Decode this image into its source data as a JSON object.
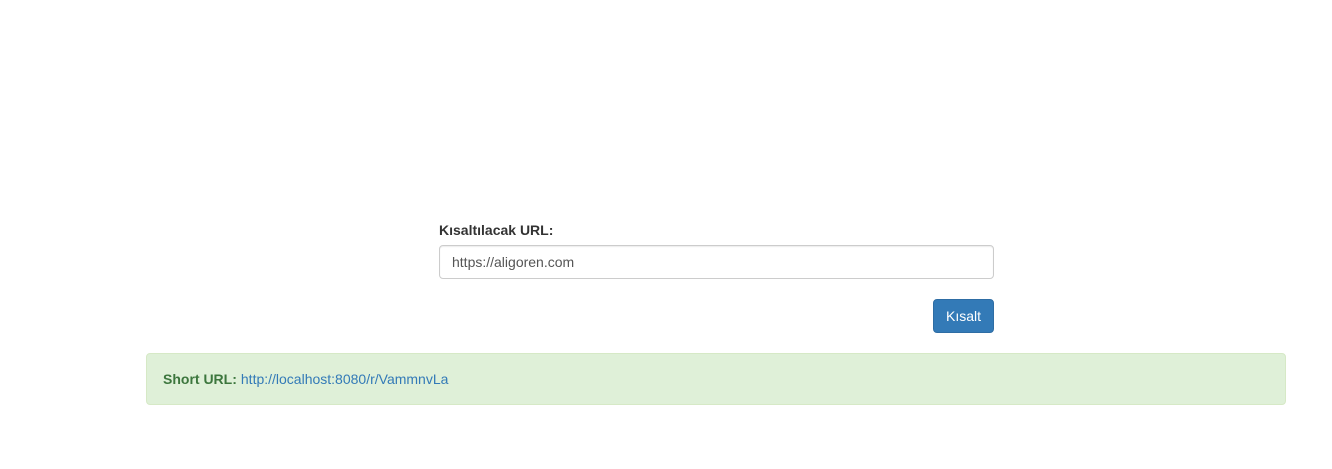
{
  "form": {
    "label": "Kısaltılacak URL:",
    "input_value": "https://aligoren.com",
    "submit_label": "Kısalt"
  },
  "result": {
    "label": "Short URL:",
    "short_url": "http://localhost:8080/r/VammnvLa"
  },
  "colors": {
    "primary": "#337ab7",
    "success_bg": "#dff0d8",
    "success_text": "#3c763d"
  }
}
